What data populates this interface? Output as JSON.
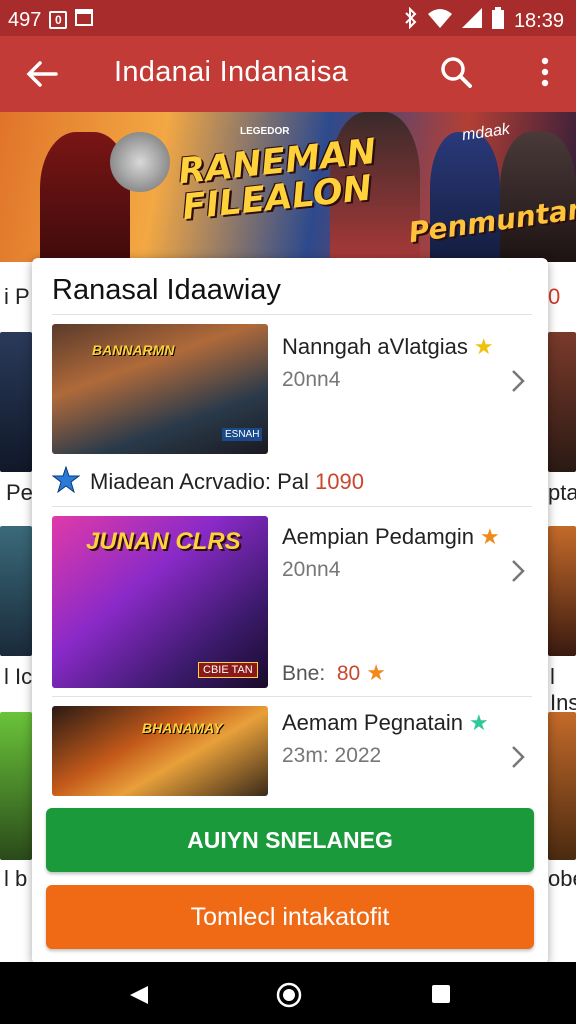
{
  "status_bar": {
    "left_number": "497",
    "left_icon_box": "0",
    "time": "18:39",
    "icons": [
      "bluetooth-icon",
      "wifi-icon",
      "signal-icon",
      "battery-icon"
    ]
  },
  "app_bar": {
    "title": "Indanai Indanaisa",
    "icons": [
      "back-arrow-icon",
      "search-icon",
      "more-vert-icon"
    ]
  },
  "hero": {
    "title_line1": "RANEMAN",
    "title_line2": "FILEALON",
    "subtitle": "Penmuntan",
    "tagline": "mdaak",
    "small_tag": "LEGEDOR"
  },
  "background_list": {
    "row_left_labels": [
      "i P",
      "Pe",
      "l Ic",
      "l b"
    ],
    "row_right_labels": [
      "0",
      "ptar",
      "l Ins",
      "obe"
    ]
  },
  "card": {
    "title": "Ranasal Idaawiay",
    "items": [
      {
        "name": "Nanngah aVlatgias",
        "sub": "20nn4",
        "star_color": "#f2c10f",
        "thumb_title": "BANNARMN",
        "thumb_badge": "ESNAH"
      },
      {
        "name": "Aempian Pedamgin",
        "sub": "20nn4",
        "extra_label": "Bne:",
        "extra_value": "80",
        "star_color": "#f08a1c",
        "thumb_title": "JUNAN CLRS",
        "thumb_badge": "CBIE TAN"
      },
      {
        "name": "Aemam Pegnatain",
        "sub": "23m: 2022",
        "star_color": "#2fc89a",
        "thumb_title": "BHANAMAY"
      }
    ],
    "promo": {
      "label": "Miadean Acrvadio: Pal",
      "value": "1090"
    },
    "buttons": {
      "primary": "AUIYN SNELANEG",
      "secondary": "Tomlecl intakatofit"
    }
  },
  "colors": {
    "app_bar": "#c23b36",
    "status_bar": "#a92c2c",
    "primary_button": "#1a9a3b",
    "secondary_button": "#f06a16",
    "accent_number": "#c8472d"
  }
}
